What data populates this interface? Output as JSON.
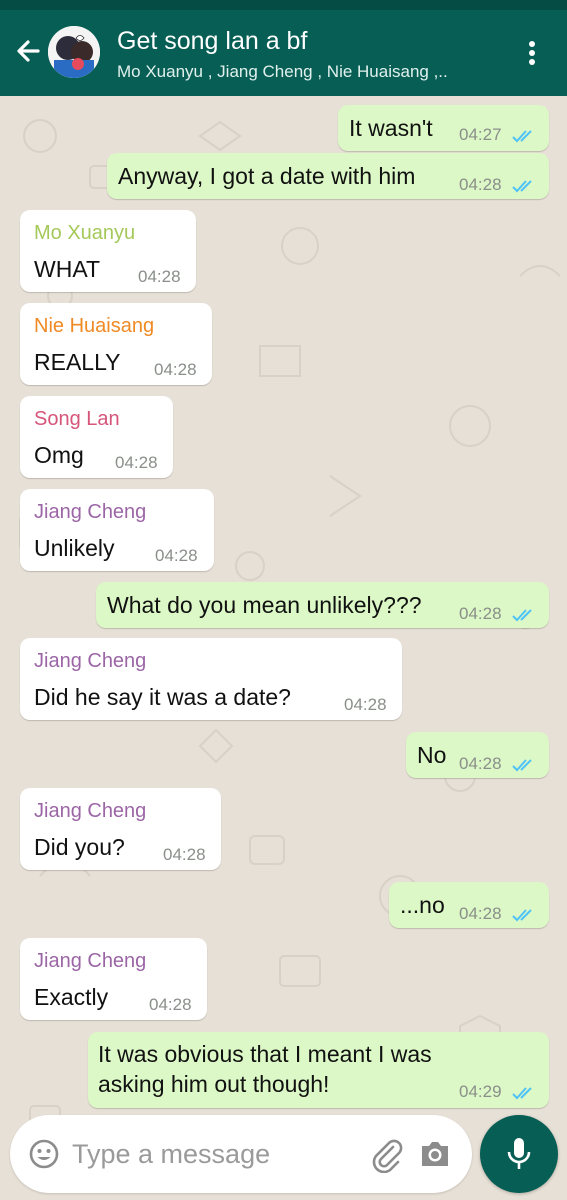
{
  "header": {
    "title": "Get song lan a bf",
    "subtitle": "Mo Xuanyu , Jiang Cheng , Nie Huaisang ,..",
    "back_icon": "arrow-left-icon",
    "menu_icon": "more-vert-icon"
  },
  "colors": {
    "header": "#075e54",
    "outgoing_bubble": "#dcf8c6",
    "incoming_bubble": "#ffffff",
    "read_ticks": "#4fc3f7",
    "mo_xuanyu": "#a5c85a",
    "nie_huaisang": "#f08a24",
    "song_lan": "#d6557a",
    "jiang_cheng": "#9c66a6"
  },
  "messages": [
    {
      "dir": "out",
      "text": "It wasn't",
      "time": "04:27"
    },
    {
      "dir": "out",
      "text": "Anyway, I got a date with him",
      "time": "04:28"
    },
    {
      "dir": "in",
      "sender": "Mo Xuanyu",
      "text": "WHAT",
      "time": "04:28"
    },
    {
      "dir": "in",
      "sender": "Nie Huaisang",
      "text": "REALLY",
      "time": "04:28"
    },
    {
      "dir": "in",
      "sender": "Song Lan",
      "text": "Omg",
      "time": "04:28"
    },
    {
      "dir": "in",
      "sender": "Jiang Cheng",
      "text": "Unlikely",
      "time": "04:28"
    },
    {
      "dir": "out",
      "text": "What do you mean unlikely???",
      "time": "04:28"
    },
    {
      "dir": "in",
      "sender": "Jiang Cheng",
      "text": "Did he say it was a date?",
      "time": "04:28"
    },
    {
      "dir": "out",
      "text": "No",
      "time": "04:28"
    },
    {
      "dir": "in",
      "sender": "Jiang Cheng",
      "text": "Did you?",
      "time": "04:28"
    },
    {
      "dir": "out",
      "text": "...no",
      "time": "04:28"
    },
    {
      "dir": "in",
      "sender": "Jiang Cheng",
      "text": "Exactly",
      "time": "04:28"
    },
    {
      "dir": "out",
      "text_line1": "It was obvious that I meant I was",
      "text_line2": "asking him out though!",
      "time": "04:29"
    }
  ],
  "composer": {
    "placeholder": "Type a message",
    "emoji_icon": "emoji-icon",
    "attach_icon": "paperclip-icon",
    "camera_icon": "camera-icon",
    "mic_icon": "mic-icon"
  }
}
